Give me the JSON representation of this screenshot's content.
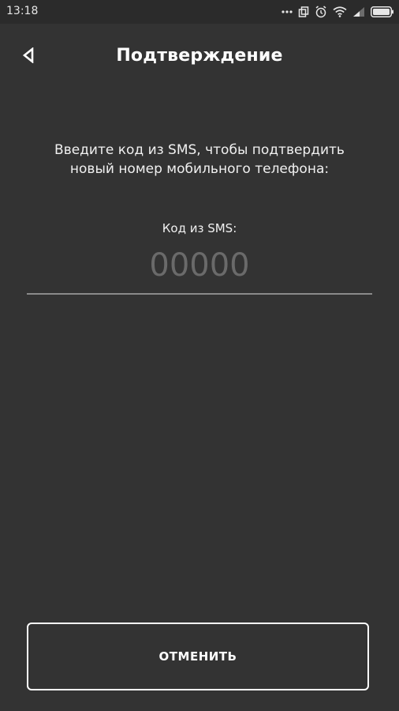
{
  "status_bar": {
    "time": "13:18",
    "icons": [
      "more-dots-icon",
      "copy-icon",
      "alarm-icon",
      "wifi-icon",
      "signal-icon",
      "battery-icon"
    ]
  },
  "header": {
    "back_icon": "back-triangle-icon",
    "title": "Подтверждение"
  },
  "instruction": {
    "line1": "Введите код из SMS, чтобы подтвердить",
    "line2": "новый номер мобильного телефона:"
  },
  "code_field": {
    "label": "Код из SMS:",
    "value": "",
    "placeholder": "00000"
  },
  "cancel_button": {
    "label": "ОТМЕНИТЬ"
  },
  "colors": {
    "background": "#333333",
    "status_bar": "#2b2b2b",
    "text": "#ffffff",
    "placeholder": "#6a6a6a",
    "underline": "#8a8a8a"
  }
}
